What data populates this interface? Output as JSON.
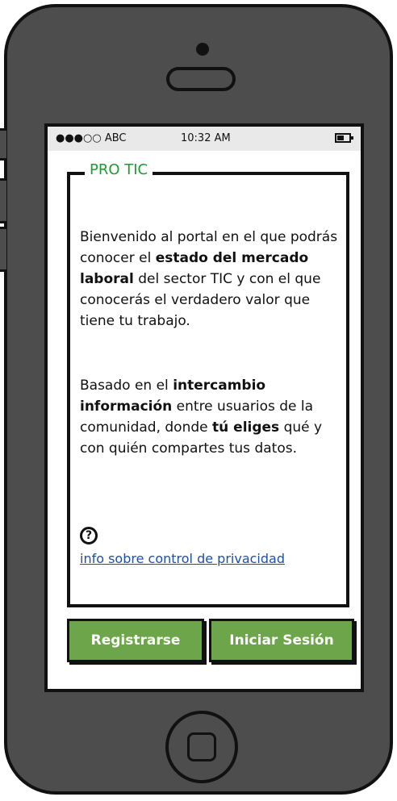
{
  "status_bar": {
    "carrier": "●●●○○ ABC",
    "time": "10:32 AM"
  },
  "panel": {
    "title": "PRO TIC"
  },
  "intro": {
    "part1": "Bienvenido al portal en el que podrás conocer el ",
    "bold1": "estado del mercado laboral",
    "part2": " del sector TIC y con el que conocerás el verdadero valor que tiene tu trabajo."
  },
  "detail": {
    "part1": "Basado en el ",
    "bold1": "intercambio información",
    "part2": " entre usuarios de la comunidad, donde ",
    "bold2": "tú eliges",
    "part3": " qué y con quién compartes tus datos."
  },
  "help": {
    "icon": "?",
    "link_label": "info sobre control de privacidad"
  },
  "buttons": {
    "register_label": "Registrarse",
    "login_label": "Iniciar Sesión"
  },
  "colors": {
    "accent_green": "#6ca54a",
    "title_green": "#1c9c32",
    "link_blue": "#1f4fa5"
  }
}
